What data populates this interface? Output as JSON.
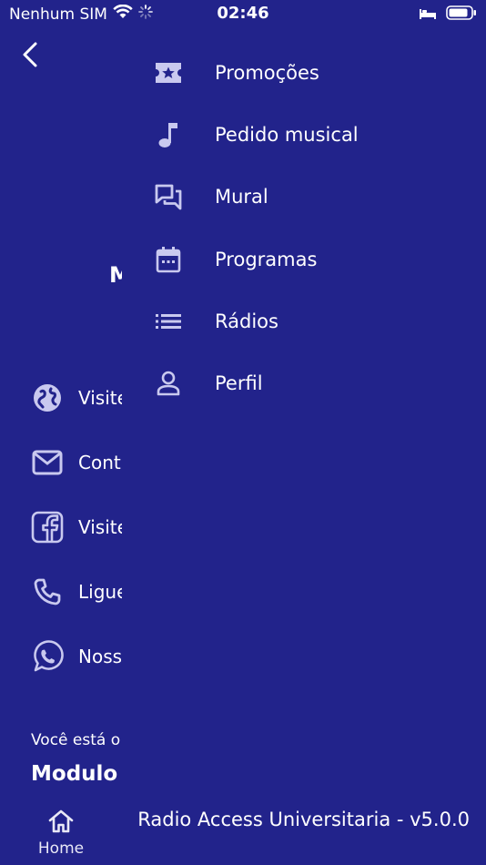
{
  "status_bar": {
    "carrier": "Nenhum SIM",
    "time": "02:46"
  },
  "background": {
    "title_fragment": "M",
    "links": [
      {
        "icon": "globe-icon",
        "label": "Visite"
      },
      {
        "icon": "mail-icon",
        "label": "Cont"
      },
      {
        "icon": "facebook-icon",
        "label": "Visite"
      },
      {
        "icon": "phone-icon",
        "label": "Ligue"
      },
      {
        "icon": "whatsapp-icon",
        "label": "Noss"
      }
    ],
    "subtitle_fragment": "Você está o",
    "bold_fragment": "Modulo I"
  },
  "menu": {
    "items": [
      {
        "icon": "ticket-star-icon",
        "label": "Promoções"
      },
      {
        "icon": "music-note-icon",
        "label": "Pedido musical"
      },
      {
        "icon": "chat-bubbles-icon",
        "label": "Mural"
      },
      {
        "icon": "calendar-icon",
        "label": "Programas"
      },
      {
        "icon": "list-icon",
        "label": "Rádios"
      },
      {
        "icon": "user-icon",
        "label": "Perfil"
      }
    ],
    "version": "Radio Access Universitaria - v5.0.0"
  },
  "tab_bar": {
    "home_label": "Home"
  },
  "colors": {
    "background": "#22238b",
    "icon": "#c9c9ef",
    "text": "#ffffff"
  }
}
